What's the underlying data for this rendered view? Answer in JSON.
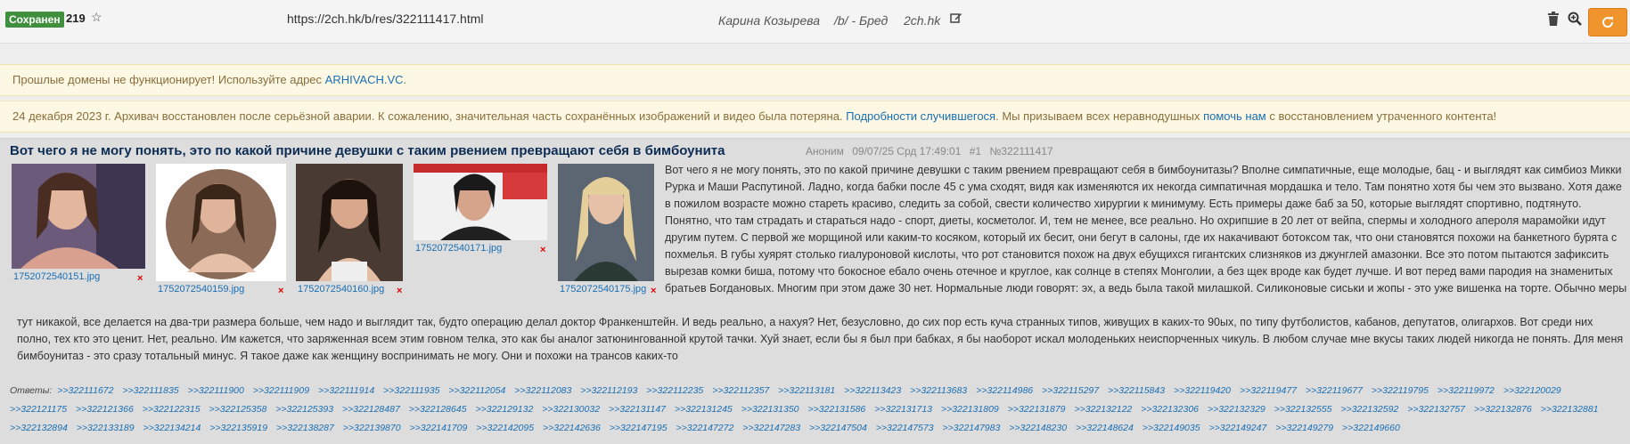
{
  "topbar": {
    "saved_label": "Сохранен",
    "count": "219",
    "star_icon": "star-icon",
    "url": "https://2ch.hk/b/res/322111417.html",
    "author": "Карина Козырева",
    "board": "/b/ - Бред",
    "site": "2ch.hk",
    "edit_icon": "edit-icon",
    "trash_icon": "trash-icon",
    "zoom_icon": "zoom-icon",
    "refresh_icon": "refresh-icon",
    "accent_color": "#f0942d",
    "badge_color": "#3f8f3f"
  },
  "notices": {
    "domains": {
      "text": "Прошлые домены не функционирует! Используйте адрес ",
      "link": "ARHIVACH.VC",
      "suffix": "."
    },
    "restore": {
      "text1": "24 декабря 2023 г. Архивач восстановлен после серьёзной аварии. К сожалению, значительная часть сохранённых изображений и видео была потеряна. ",
      "link1": "Подробности случившегося",
      "text2": ". Мы призываем всех неравнодушных ",
      "link2": "помочь нам",
      "text3": " с восстановлением утраченного контента!"
    }
  },
  "post": {
    "title": "Вот чего я не могу понять, это по какой причине девушки с таким рвением превращают себя в бимбоунита",
    "author": "Аноним",
    "date": "09/07/25 Срд 17:49:01",
    "num": "#1",
    "id": "№322111417",
    "images": [
      {
        "filename": "1752072540151.jpg"
      },
      {
        "filename": "1752072540159.jpg"
      },
      {
        "filename": "1752072540160.jpg"
      },
      {
        "filename": "1752072540171.jpg"
      },
      {
        "filename": "1752072540175.jpg"
      }
    ],
    "delete_mark": "×",
    "text_right": "Вот чего я не могу понять, это по какой причине девушки с таким рвением превращают себя в бимбоунитазы? Вполне симпатичные, еще молодые, бац - и выглядят как симбиоз Микки Рурка и Маши Распутиной. Ладно, когда бабки после 45 с ума сходят, видя как изменяются их некогда симпатичная мордашка и тело. Там понятно хотя бы чем это вызвано. Хотя даже в пожилом возрасте можно стареть красиво, следить за собой, свести количество хирургии к минимуму. Есть примеры даже баб за 50, которые выглядят спортивно, подтянуто. Понятно, что там страдать и стараться надо - спорт, диеты, косметолог. И, тем не менее, все реально. Но охрипшие в 20 лет от вейпа, спермы и холодного апероля марамойки идут другим путем. С первой же морщиной или каким-то косяком, который их бесит, они бегут в салоны, где их накачивают ботоксом так, что они становятся похожи на банкетного бурята с похмелья. В губы хуярят столько гиалуроновой кислоты, что рот становится похож на двух ебущихся гигантских слизняков из джунглей амазонки. Все это потом пытаются зафиксить вырезав комки биша, потому что бокосное ебало очень отечное и круглое, как солнце в степях Монголии, а без щек вроде как будет лучше. И вот перед вами пародия на знаменитых братьев Богдановых. Многим при этом даже 30 нет. Нормальные люди говорят: эх, а ведь была такой милашкой. Силиконовые сиськи и жопы - это уже вишенка на торте. Обычно меры",
    "text_full": "тут никакой, все делается на два-три размера больше, чем надо и выглядит так, будто операцию делал доктор Франкенштейн. И ведь реально, а нахуя? Нет, безусловно, до сих пор есть куча странных типов, живущих в каких-то 90ых, по типу футболистов, кабанов, депутатов, олигархов. Вот среди них полно, тех кто это ценит. Нет, реально. Им кажется, что заряженная всем этим говном телка, это как бы аналог затюнингованной крутой тачки. Хуй знает, если бы я был при бабках, я бы наоборот искал молоденьких неиспорченных чикуль. В любом случае мне вкусы таких людей никогда не понять. Для меня бимбоунитаз - это сразу тотальный минус. Я такое даже как женщину воспринимать не могу. Они и похожи на трансов каких-то",
    "replies_label": "Ответы:",
    "replies": [
      ">>322111672",
      ">>322111835",
      ">>322111900",
      ">>322111909",
      ">>322111914",
      ">>322111935",
      ">>322112054",
      ">>322112083",
      ">>322112193",
      ">>322112235",
      ">>322112357",
      ">>322113181",
      ">>322113423",
      ">>322113683",
      ">>322114986",
      ">>322115297",
      ">>322115843",
      ">>322119420",
      ">>322119477",
      ">>322119677",
      ">>322119795",
      ">>322119972",
      ">>322120029",
      ">>322121175",
      ">>322121366",
      ">>322122315",
      ">>322125358",
      ">>322125393",
      ">>322128487",
      ">>322128645",
      ">>322129132",
      ">>322130032",
      ">>322131147",
      ">>322131245",
      ">>322131350",
      ">>322131586",
      ">>322131713",
      ">>322131809",
      ">>322131879",
      ">>322132122",
      ">>322132306",
      ">>322132329",
      ">>322132555",
      ">>322132592",
      ">>322132757",
      ">>322132876",
      ">>322132881",
      ">>322132894",
      ">>322133189",
      ">>322134214",
      ">>322135919",
      ">>322138287",
      ">>322139870",
      ">>322141709",
      ">>322142095",
      ">>322142636",
      ">>322147195",
      ">>322147272",
      ">>322147283",
      ">>322147504",
      ">>322147573",
      ">>322147983",
      ">>322148230",
      ">>322148624",
      ">>322149035",
      ">>322149247",
      ">>322149279",
      ">>322149660"
    ]
  }
}
